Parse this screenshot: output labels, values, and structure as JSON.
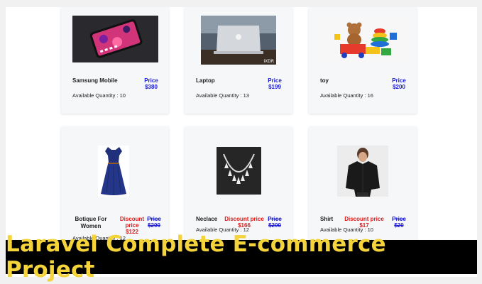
{
  "products": [
    {
      "name": "Samsung Mobile",
      "price_label": "Price",
      "price": "$380",
      "qty": "Available Quantity : 10"
    },
    {
      "name": "Laptop",
      "price_label": "Price",
      "price": "$199",
      "qty": "Available Quantity : 13"
    },
    {
      "name": "toy",
      "price_label": "Price",
      "price": "$200",
      "qty": "Available Quantity : 16"
    },
    {
      "name_lines": [
        "Botique For",
        "Women"
      ],
      "discount_label": "Discount price",
      "discount_price": "$122",
      "old_label": "Price",
      "old_price": "$200",
      "qty": "Available Quantity : 12"
    },
    {
      "name": "Neclace",
      "discount_label": "Discount price",
      "discount_price": "$166",
      "old_label": "Price",
      "old_price": "$200",
      "qty": "Available Quantity : 12"
    },
    {
      "name": "Shirt",
      "discount_label": "Discount price",
      "discount_price": "$17",
      "old_label": "Price",
      "old_price": "$20",
      "qty": "Available Quantity : 10"
    }
  ],
  "laptop_watermark": "IXDR",
  "banner": {
    "title": "Laravel Complete E-commerce Project"
  },
  "colors": {
    "price_blue": "#1a1ad6",
    "discount_red": "#e01818",
    "banner_bg": "#000000",
    "banner_text": "#f5d33b"
  }
}
